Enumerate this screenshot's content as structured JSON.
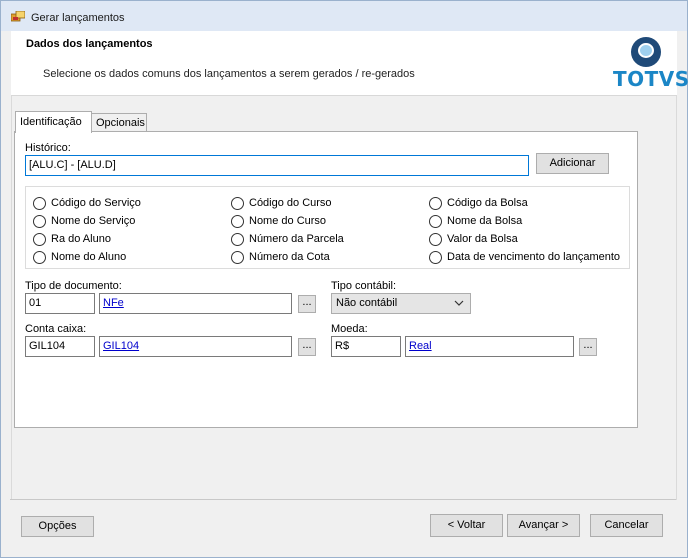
{
  "window": {
    "title": "Gerar lançamentos"
  },
  "header": {
    "title": "Dados dos lançamentos",
    "subtitle": "Selecione os dados comuns dos lançamentos a serem gerados / re-gerados",
    "logo_text": "TOTVS"
  },
  "tabs": [
    {
      "label": "Identificação",
      "active": true
    },
    {
      "label": "Opcionais",
      "active": false
    }
  ],
  "historico": {
    "label": "Histórico:",
    "value": "[ALU.C] - [ALU.D]",
    "add_button": "Adicionar"
  },
  "options": [
    "Código do Serviço",
    "Código do Curso",
    "Código da Bolsa",
    "Nome do Serviço",
    "Nome do Curso",
    "Nome da Bolsa",
    "Ra do Aluno",
    "Número da Parcela",
    "Valor da Bolsa",
    "Nome do Aluno",
    "Número da Cota",
    "Data de vencimento do lançamento"
  ],
  "tipo_documento": {
    "label": "Tipo de documento:",
    "code": "01",
    "name": "NFe",
    "lookup": "..."
  },
  "tipo_contabil": {
    "label": "Tipo contábil:",
    "value": "Não contábil"
  },
  "conta_caixa": {
    "label": "Conta caixa:",
    "code": "GIL104",
    "name": "GIL104",
    "lookup": "..."
  },
  "moeda": {
    "label": "Moeda:",
    "code": "R$",
    "name": "Real",
    "lookup": "..."
  },
  "footer": {
    "options_button": "Opções",
    "back_button": "< Voltar",
    "next_button": "Avançar >",
    "cancel_button": "Cancelar"
  },
  "colors": {
    "accent": "#0078d7",
    "link": "#0000cc",
    "logo_blue": "#1b86c6",
    "logo_dark": "#1f4a78"
  }
}
